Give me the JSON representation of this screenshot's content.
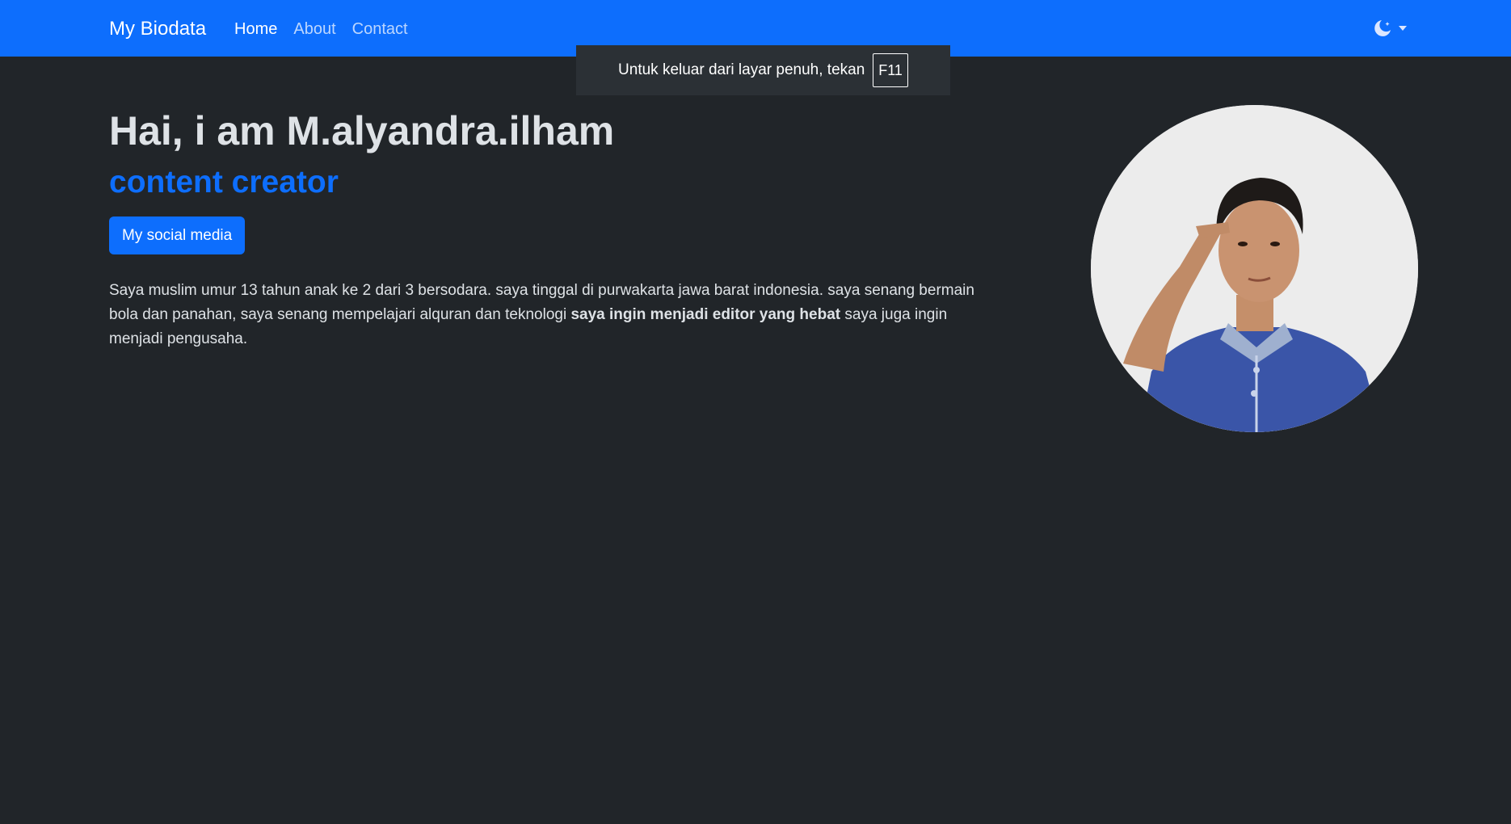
{
  "navbar": {
    "brand": "My Biodata",
    "links": [
      {
        "label": "Home",
        "active": true
      },
      {
        "label": "About",
        "active": false
      },
      {
        "label": "Contact",
        "active": false
      }
    ],
    "theme_icon": "moon-stars-icon",
    "dropdown_icon": "caret-down-icon"
  },
  "fullscreen_notice": {
    "text": "Untuk keluar dari layar penuh, tekan",
    "key": "F11"
  },
  "hero": {
    "title": "Hai, i am M.alyandra.ilham",
    "subtitle": "content creator",
    "button_label": "My social media",
    "bio_part1": "Saya muslim umur 13 tahun anak ke 2 dari 3 bersodara. saya tinggal di purwakarta jawa barat indonesia. saya senang bermain bola dan panahan, saya senang mempelajari alquran dan teknologi ",
    "bio_bold": "saya ingin menjadi editor yang hebat",
    "bio_part2": " saya juga ingin menjadi pengusaha."
  },
  "colors": {
    "primary": "#0d6efd",
    "background": "#212529",
    "text": "#dee2e6"
  }
}
